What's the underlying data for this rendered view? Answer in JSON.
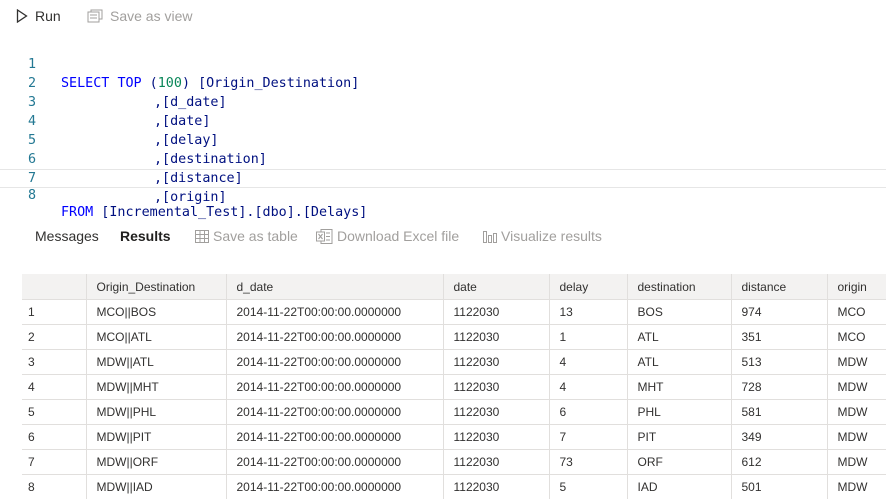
{
  "toolbar": {
    "run_label": "Run",
    "save_view_label": "Save as view"
  },
  "editor": {
    "lines": [
      {
        "num": "1"
      },
      {
        "num": "2"
      },
      {
        "num": "3"
      },
      {
        "num": "4"
      },
      {
        "num": "5"
      },
      {
        "num": "6"
      },
      {
        "num": "7"
      },
      {
        "num": "8"
      }
    ],
    "tokens": {
      "select": "SELECT",
      "top": "TOP",
      "paren_open": " (",
      "top_value": "100",
      "paren_close": ") ",
      "col1": "[Origin_Destination]",
      "col2": ",[d_date]",
      "col3": ",[date]",
      "col4": ",[delay]",
      "col5": ",[destination]",
      "col6": ",[distance]",
      "col7": ",[origin]",
      "from": "FROM",
      "table": " [Incremental_Test].[dbo].[Delays]"
    }
  },
  "tabs": {
    "messages": "Messages",
    "results": "Results",
    "save_table": "Save as table",
    "download_excel": "Download Excel file",
    "visualize": "Visualize results"
  },
  "grid": {
    "columns": [
      "",
      "Origin_Destination",
      "d_date",
      "date",
      "delay",
      "destination",
      "distance",
      "origin"
    ],
    "rows": [
      [
        "1",
        "MCO||BOS",
        "2014-11-22T00:00:00.0000000",
        "1122030",
        "13",
        "BOS",
        "974",
        "MCO"
      ],
      [
        "2",
        "MCO||ATL",
        "2014-11-22T00:00:00.0000000",
        "1122030",
        "1",
        "ATL",
        "351",
        "MCO"
      ],
      [
        "3",
        "MDW||ATL",
        "2014-11-22T00:00:00.0000000",
        "1122030",
        "4",
        "ATL",
        "513",
        "MDW"
      ],
      [
        "4",
        "MDW||MHT",
        "2014-11-22T00:00:00.0000000",
        "1122030",
        "4",
        "MHT",
        "728",
        "MDW"
      ],
      [
        "5",
        "MDW||PHL",
        "2014-11-22T00:00:00.0000000",
        "1122030",
        "6",
        "PHL",
        "581",
        "MDW"
      ],
      [
        "6",
        "MDW||PIT",
        "2014-11-22T00:00:00.0000000",
        "1122030",
        "7",
        "PIT",
        "349",
        "MDW"
      ],
      [
        "7",
        "MDW||ORF",
        "2014-11-22T00:00:00.0000000",
        "1122030",
        "73",
        "ORF",
        "612",
        "MDW"
      ],
      [
        "8",
        "MDW||IAD",
        "2014-11-22T00:00:00.0000000",
        "1122030",
        "5",
        "IAD",
        "501",
        "MDW"
      ]
    ]
  }
}
